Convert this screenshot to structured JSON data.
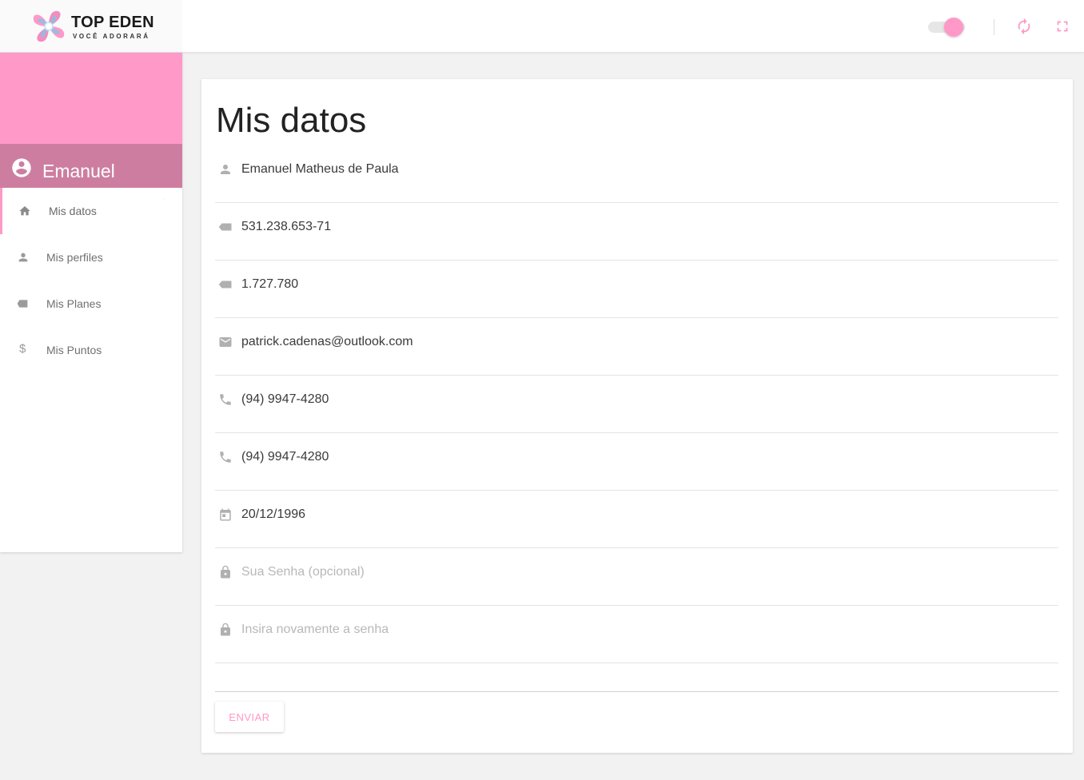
{
  "brand": {
    "title": "TOP EDEN",
    "subtitle": "VOCÊ ADORARÁ",
    "logo_icon": "flower-logo-icon"
  },
  "colors": {
    "accent": "#ff99c8",
    "accent_dark": "#cd7ea0",
    "background": "#f2f2f2",
    "card": "#ffffff"
  },
  "topbar": {
    "toggle_on": true,
    "icons": [
      "refresh-icon",
      "fullscreen-icon"
    ]
  },
  "sidebar": {
    "user_name": "Emanuel Matheus de Paula",
    "items": [
      {
        "label": "Mis datos",
        "icon": "home-icon",
        "active": true
      },
      {
        "label": "Mis perfiles",
        "icon": "person-icon",
        "active": false
      },
      {
        "label": "Mis Planes",
        "icon": "tag-icon",
        "active": false
      },
      {
        "label": "Mis Puntos",
        "icon": "dollar-icon",
        "active": false
      }
    ]
  },
  "form": {
    "title": "Mis datos",
    "fields": [
      {
        "icon": "person-icon",
        "value": "Emanuel Matheus de Paula",
        "placeholder": ""
      },
      {
        "icon": "tag-icon",
        "value": "531.238.653-71",
        "placeholder": ""
      },
      {
        "icon": "tag-icon",
        "value": "1.727.780",
        "placeholder": ""
      },
      {
        "icon": "email-icon",
        "value": "patrick.cadenas@outlook.com",
        "placeholder": ""
      },
      {
        "icon": "phone-icon",
        "value": "(94) 9947-4280",
        "placeholder": ""
      },
      {
        "icon": "phone-icon",
        "value": "(94) 9947-4280",
        "placeholder": ""
      },
      {
        "icon": "calendar-icon",
        "value": "20/12/1996",
        "placeholder": ""
      },
      {
        "icon": "lock-icon",
        "value": "",
        "placeholder": "Sua Senha (opcional)"
      },
      {
        "icon": "lock-icon",
        "value": "",
        "placeholder": "Insira novamente a senha"
      }
    ],
    "submit_label": "ENVIAR"
  }
}
